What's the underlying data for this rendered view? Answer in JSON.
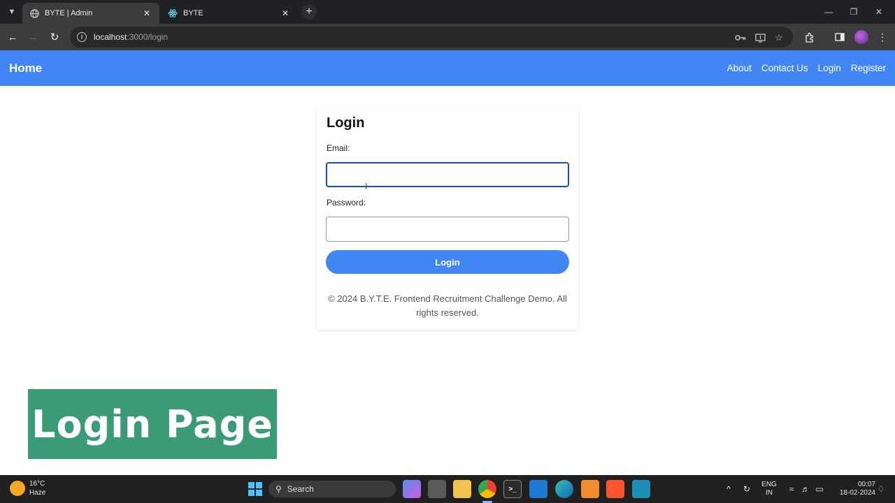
{
  "browser": {
    "tabs": [
      {
        "title": "BYTE | Admin",
        "active": true
      },
      {
        "title": "BYTE",
        "active": false
      }
    ],
    "url_host": "localhost",
    "url_path": ":3000/login"
  },
  "app_nav": {
    "brand": "Home",
    "links": [
      "About",
      "Contact Us",
      "Login",
      "Register"
    ],
    "color": "#4285f4"
  },
  "login": {
    "title": "Login",
    "email_label": "Email:",
    "email_value": "",
    "password_label": "Password:",
    "password_value": "",
    "button_label": "Login",
    "footer": "© 2024 B.Y.T.E. Frontend Recruitment Challenge Demo. All rights reserved."
  },
  "banner": {
    "text": "Login Page",
    "color": "#3a9b76"
  },
  "taskbar": {
    "temperature": "16°C",
    "condition": "Haze",
    "search_label": "Search",
    "language": "ENG",
    "region": "IN",
    "time": "00:07",
    "date": "18-02-2024"
  }
}
